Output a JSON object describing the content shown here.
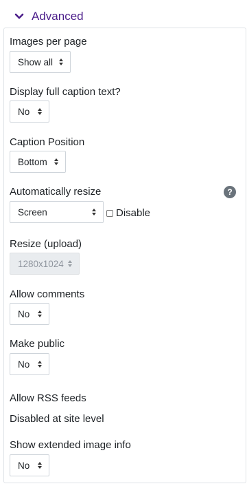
{
  "section": {
    "title": "Advanced",
    "icon": "chevron-down-icon"
  },
  "fields": {
    "images_per_page": {
      "label": "Images per page",
      "value": "Show all"
    },
    "display_full_caption": {
      "label": "Display full caption text?",
      "value": "No"
    },
    "caption_position": {
      "label": "Caption Position",
      "value": "Bottom"
    },
    "auto_resize": {
      "label": "Automatically resize",
      "value": "Screen",
      "checkbox_label": "Disable",
      "help_icon": "?"
    },
    "resize_upload": {
      "label": "Resize (upload)",
      "value": "1280x1024"
    },
    "allow_comments": {
      "label": "Allow comments",
      "value": "No"
    },
    "make_public": {
      "label": "Make public",
      "value": "No"
    },
    "allow_rss": {
      "label": "Allow RSS feeds",
      "value": "Disabled at site level"
    },
    "extended_info": {
      "label": "Show extended image info",
      "value": "No"
    }
  },
  "colors": {
    "accent": "#4b1d8a",
    "help_bg": "#6a737b",
    "border": "#ced4da"
  }
}
